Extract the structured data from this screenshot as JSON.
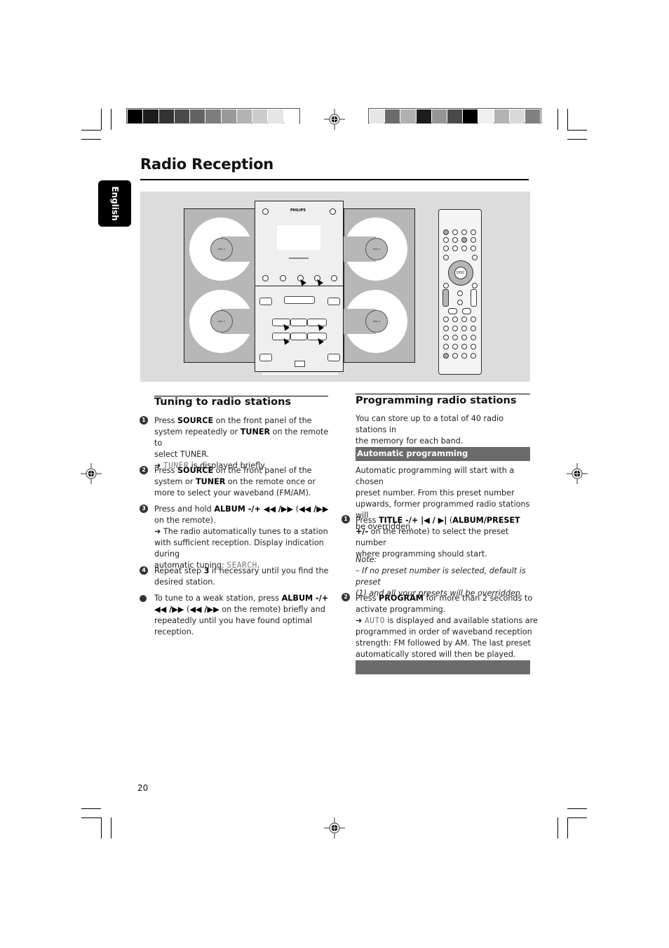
{
  "page": {
    "title": "Radio Reception",
    "language_tab": "English",
    "page_number": "20"
  },
  "color_bars": {
    "left": [
      "#000000",
      "#1c1c1c",
      "#333333",
      "#4a4a4a",
      "#636363",
      "#7d7d7d",
      "#999999",
      "#b3b3b3",
      "#cccccc",
      "#e6e6e6",
      "#ffffff"
    ],
    "right": [
      "#e6e6e6",
      "#6b6b6b",
      "#b0b0b0",
      "#1c1c1c",
      "#969696",
      "#4a4a4a",
      "#000000",
      "#f0f0f0",
      "#b3b3b3",
      "#d9d9d9",
      "#808080"
    ]
  },
  "illustration": {
    "brand": "PHILIPS",
    "disc_labels": [
      "DISC 1",
      "DISC 2",
      "DISC 3",
      "DISC 4"
    ],
    "remote_center_label": "DISC"
  },
  "tuning": {
    "heading": "Tuning to radio stations",
    "steps": [
      {
        "marker": "1",
        "lines": [
          {
            "parts": [
              {
                "t": "Press "
              },
              {
                "b": "SOURCE"
              },
              {
                "t": " on the front panel of the"
              }
            ]
          },
          {
            "parts": [
              {
                "t": "system repeatedly or "
              },
              {
                "b": "TUNER"
              },
              {
                "t": " on the remote to"
              }
            ]
          },
          {
            "parts": [
              {
                "t": "select TUNER."
              }
            ]
          },
          {
            "parts": [
              {
                "t": "➜ "
              },
              {
                "lcd": "TUNER"
              },
              {
                "t": " is displayed briefly."
              }
            ]
          }
        ]
      },
      {
        "marker": "2",
        "lines": [
          {
            "parts": [
              {
                "t": "Press "
              },
              {
                "b": "SOURCE"
              },
              {
                "t": " on the front panel of the"
              }
            ]
          },
          {
            "parts": [
              {
                "t": "system or "
              },
              {
                "b": "TUNER"
              },
              {
                "t": " on the remote once or"
              }
            ]
          },
          {
            "parts": [
              {
                "t": "more to select your waveband (FM/AM)."
              }
            ]
          }
        ]
      },
      {
        "marker": "3",
        "lines": [
          {
            "parts": [
              {
                "t": "Press and hold "
              },
              {
                "b": "ALBUM -/+ ◀◀ /▶▶"
              },
              {
                "t": " ("
              },
              {
                "b": "◀◀ /▶▶"
              }
            ]
          },
          {
            "parts": [
              {
                "t": "on the remote)."
              }
            ]
          },
          {
            "parts": [
              {
                "t": "➜ The radio automatically tunes to a station"
              }
            ]
          },
          {
            "parts": [
              {
                "t": "with sufficient reception. Display indication during"
              }
            ]
          },
          {
            "parts": [
              {
                "t": "automatic tuning: "
              },
              {
                "lcd": "SEARCH"
              },
              {
                "t": "."
              }
            ]
          }
        ]
      },
      {
        "marker": "4",
        "lines": [
          {
            "parts": [
              {
                "t": "Repeat step "
              },
              {
                "b": "3"
              },
              {
                "t": " if necessary until you find the"
              }
            ]
          },
          {
            "parts": [
              {
                "t": "desired station."
              }
            ]
          }
        ]
      },
      {
        "marker": "bullet",
        "lines": [
          {
            "parts": [
              {
                "t": "To tune to a weak station, press "
              },
              {
                "b": "ALBUM -/+"
              }
            ]
          },
          {
            "parts": [
              {
                "b": "◀◀ /▶▶"
              },
              {
                "t": " ("
              },
              {
                "b": "◀◀ /▶▶"
              },
              {
                "t": "  on the remote) briefly and"
              }
            ]
          },
          {
            "parts": [
              {
                "t": "repeatedly until you have found optimal"
              }
            ]
          },
          {
            "parts": [
              {
                "t": "reception."
              }
            ]
          }
        ]
      }
    ]
  },
  "programming": {
    "heading": "Programming radio stations",
    "intro": [
      "You can store up to a total of 40 radio stations in",
      "the memory for each band."
    ],
    "subheading": "Automatic programming",
    "auto_intro": [
      "Automatic programming will start with a chosen",
      "preset number. From this preset number",
      "upwards, former programmed radio stations will",
      "be overridden."
    ],
    "step1": {
      "marker": "1",
      "lines": [
        {
          "parts": [
            {
              "t": "Press "
            },
            {
              "b": "TITLE -/+  |◀ / ▶|"
            },
            {
              "t": "  ("
            },
            {
              "b": "ALBUM/PRESET"
            }
          ]
        },
        {
          "parts": [
            {
              "b": "+/-"
            },
            {
              "t": "  on the remote) to select the preset number"
            }
          ]
        },
        {
          "parts": [
            {
              "t": "where programming should start."
            }
          ]
        }
      ]
    },
    "note": {
      "label": "Note:",
      "lines": [
        "–  If no preset number is selected, default is preset",
        "(1) and all your presets will be overridden."
      ]
    },
    "step2": {
      "marker": "2",
      "lines": [
        {
          "parts": [
            {
              "t": "Press "
            },
            {
              "b": "PROGRAM"
            },
            {
              "t": " for more than 2 seconds to"
            }
          ]
        },
        {
          "parts": [
            {
              "t": "activate programming."
            }
          ]
        },
        {
          "parts": [
            {
              "t": "➜ "
            },
            {
              "lcd": "AUTO"
            },
            {
              "t": " is displayed and available stations are"
            }
          ]
        },
        {
          "parts": [
            {
              "t": "programmed in order of waveband reception"
            }
          ]
        },
        {
          "parts": [
            {
              "t": "strength: FM followed by AM.  The last preset"
            }
          ]
        },
        {
          "parts": [
            {
              "t": "automatically stored will then be played."
            }
          ]
        }
      ]
    }
  }
}
